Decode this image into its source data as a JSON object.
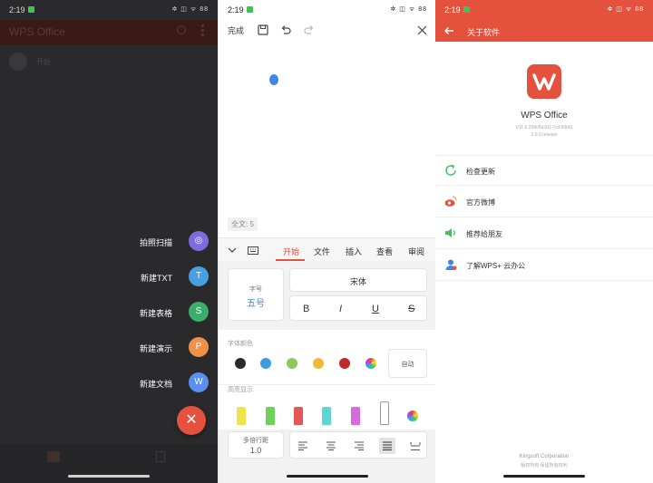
{
  "colors": {
    "accent": "#e4513c",
    "blue": "#3f86e8",
    "fab_scan": "#7b6ce0",
    "fab_txt": "#4a9fe0",
    "fab_sheet": "#3dae6a",
    "fab_ppt": "#f0914a",
    "fab_doc": "#5a8ff0"
  },
  "status": {
    "time": "2:19",
    "right": "✲ ◫ ᯤ 88"
  },
  "panel1": {
    "app_title": "WPS Office",
    "row_text": "开始",
    "fab_items": [
      {
        "label": "拍照扫描",
        "icon": "camera-icon",
        "glyph": "◎"
      },
      {
        "label": "新建TXT",
        "icon": "text-t-icon",
        "glyph": "T"
      },
      {
        "label": "新建表格",
        "icon": "sheet-s-icon",
        "glyph": "S"
      },
      {
        "label": "新建演示",
        "icon": "presentation-p-icon",
        "glyph": "P"
      },
      {
        "label": "新建文档",
        "icon": "document-w-icon",
        "glyph": "W"
      }
    ],
    "fab_close": "✕"
  },
  "panel2": {
    "done": "完成",
    "word_count": "全文: 5",
    "tabs": [
      "开始",
      "文件",
      "插入",
      "查看",
      "审阅"
    ],
    "font_size_label": "字号",
    "font_size_value": "五号",
    "font_name": "宋体",
    "format_buttons": [
      "B",
      "I",
      "U",
      "S"
    ],
    "font_color_label": "字体颜色",
    "auto_label": "自动",
    "highlight_label": "高亮显示",
    "line_spacing_label": "多倍行距",
    "line_spacing_value": "1.0",
    "font_colors": [
      "#2b2b2b",
      "#3f9be0",
      "#8ac85a",
      "#f0b93a",
      "#c02a2a"
    ],
    "highlight_colors": [
      "#f2e34a",
      "#6fd05a",
      "#e25656",
      "#5fd6d6",
      "#d86ae0",
      "#ffffff"
    ]
  },
  "panel3": {
    "title": "关于软件",
    "app_name": "WPS Office",
    "version_line1": "V11.6.2(Mi/6b2d1-7cd3f0b0)",
    "version_line2": "1.0.0.release",
    "items": [
      {
        "label": "检查更新",
        "icon": "refresh-icon"
      },
      {
        "label": "官方微博",
        "icon": "weibo-icon"
      },
      {
        "label": "推荐给朋友",
        "icon": "speaker-icon"
      },
      {
        "label": "了解WPS+ 云办公",
        "icon": "user-icon"
      }
    ],
    "footer_company": "Kingsoft Corporation",
    "footer_rights": "版权所有 保留所有权利"
  }
}
